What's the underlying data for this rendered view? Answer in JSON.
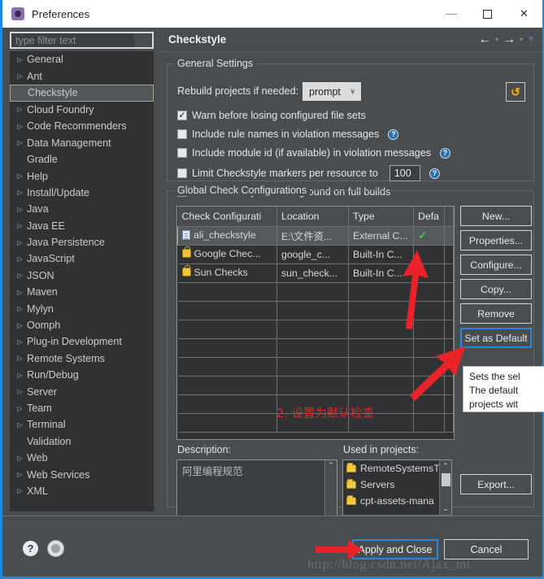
{
  "window": {
    "title": "Preferences",
    "icon": "preferences-gear-icon",
    "minimize": "minimize-icon",
    "maximize": "maximize-icon",
    "close": "close-icon"
  },
  "sidebar": {
    "filter_placeholder": "type filter text",
    "filter_value": "",
    "items": [
      {
        "label": "General",
        "expandable": true,
        "selected": false
      },
      {
        "label": "Ant",
        "expandable": true,
        "selected": false
      },
      {
        "label": "Checkstyle",
        "expandable": false,
        "selected": true
      },
      {
        "label": "Cloud Foundry",
        "expandable": true,
        "selected": false
      },
      {
        "label": "Code Recommenders",
        "expandable": true,
        "selected": false
      },
      {
        "label": "Data Management",
        "expandable": true,
        "selected": false
      },
      {
        "label": "Gradle",
        "expandable": false,
        "selected": false
      },
      {
        "label": "Help",
        "expandable": true,
        "selected": false
      },
      {
        "label": "Install/Update",
        "expandable": true,
        "selected": false
      },
      {
        "label": "Java",
        "expandable": true,
        "selected": false
      },
      {
        "label": "Java EE",
        "expandable": true,
        "selected": false
      },
      {
        "label": "Java Persistence",
        "expandable": true,
        "selected": false
      },
      {
        "label": "JavaScript",
        "expandable": true,
        "selected": false
      },
      {
        "label": "JSON",
        "expandable": true,
        "selected": false
      },
      {
        "label": "Maven",
        "expandable": true,
        "selected": false
      },
      {
        "label": "Mylyn",
        "expandable": true,
        "selected": false
      },
      {
        "label": "Oomph",
        "expandable": true,
        "selected": false
      },
      {
        "label": "Plug-in Development",
        "expandable": true,
        "selected": false
      },
      {
        "label": "Remote Systems",
        "expandable": true,
        "selected": false
      },
      {
        "label": "Run/Debug",
        "expandable": true,
        "selected": false
      },
      {
        "label": "Server",
        "expandable": true,
        "selected": false
      },
      {
        "label": "Team",
        "expandable": true,
        "selected": false
      },
      {
        "label": "Terminal",
        "expandable": true,
        "selected": false
      },
      {
        "label": "Validation",
        "expandable": false,
        "selected": false
      },
      {
        "label": "Web",
        "expandable": true,
        "selected": false
      },
      {
        "label": "Web Services",
        "expandable": true,
        "selected": false
      },
      {
        "label": "XML",
        "expandable": true,
        "selected": false
      }
    ]
  },
  "page": {
    "title": "Checkstyle",
    "nav_back": "←",
    "nav_forward": "→",
    "nav_caret": "▾",
    "menu_caret": "▼"
  },
  "general_settings": {
    "legend": "General Settings",
    "rebuild_label": "Rebuild projects if needed:",
    "rebuild_value": "prompt",
    "rebuild_caret": "∨",
    "refresh_icon": "refresh-arrows-icon",
    "checkboxes": [
      {
        "label": "Warn before losing configured file sets",
        "checked": true,
        "help": false
      },
      {
        "label": "Include rule names in violation messages",
        "checked": false,
        "help": true
      },
      {
        "label": "Include module id (if available) in violation messages",
        "checked": false,
        "help": true
      },
      {
        "label": "Limit Checkstyle markers per resource to",
        "checked": false,
        "help": true,
        "field": "100"
      },
      {
        "label": "Run Checkstyle in background on full builds",
        "checked": false,
        "help": false
      }
    ],
    "help_glyph": "?"
  },
  "global_configs": {
    "legend": "Global Check Configurations",
    "columns": [
      "Check Configurati",
      "Location",
      "Type",
      "Defa",
      ""
    ],
    "rows": [
      {
        "name": "ali_checkstyle",
        "icon": "document-icon",
        "location": "E:\\文件资...",
        "type": "External C...",
        "default": "✓",
        "selected": true
      },
      {
        "name": "Google Chec...",
        "icon": "lock-icon",
        "location": "google_c...",
        "type": "Built-In C...",
        "default": "",
        "selected": false
      },
      {
        "name": "Sun Checks",
        "icon": "lock-icon",
        "location": "sun_check...",
        "type": "Built-In C...",
        "default": "",
        "selected": false
      }
    ],
    "empty_rows": 8,
    "annotation": "2. 设置为默认检查",
    "annotation_color": "#e8232a",
    "buttons": [
      {
        "label": "New...",
        "focused": false
      },
      {
        "label": "Properties...",
        "focused": false
      },
      {
        "label": "Configure...",
        "focused": false
      },
      {
        "label": "Copy...",
        "focused": false
      },
      {
        "label": "Remove",
        "focused": false
      },
      {
        "label": "Set as Default",
        "focused": true
      }
    ],
    "export_label": "Export..."
  },
  "tooltip": {
    "line1": "Sets the sel",
    "line2": "The default",
    "line3": "projects wit"
  },
  "description": {
    "label": "Description:",
    "text": "阿里编程规范",
    "scroll_up": "⌃",
    "scroll_down": "⌄"
  },
  "used_in_projects": {
    "label": "Used in projects:",
    "items": [
      {
        "label": "RemoteSystemsT",
        "icon": "folder-icon"
      },
      {
        "label": "Servers",
        "icon": "folder-icon"
      },
      {
        "label": "cpt-assets-mana",
        "icon": "folder-icon"
      }
    ],
    "scroll_up": "⌃",
    "scroll_down": "⌄",
    "scroll_left": "‹",
    "scroll_right": "›"
  },
  "footer": {
    "help_icon": "help-question-icon",
    "help_glyph": "?",
    "pin_icon": "pin-circle-icon",
    "apply_label": "Apply and Close",
    "cancel_label": "Cancel",
    "watermark": "http://blog.csdn.net/Ajax_mt"
  },
  "accent": {
    "window_border": "#1b8ae0",
    "focus_border": "#2f86d6",
    "panel_bg": "#4a4d4f",
    "field_bg": "#3c3f41",
    "list_bg": "#2f3133",
    "text": "#e4e6e7"
  }
}
